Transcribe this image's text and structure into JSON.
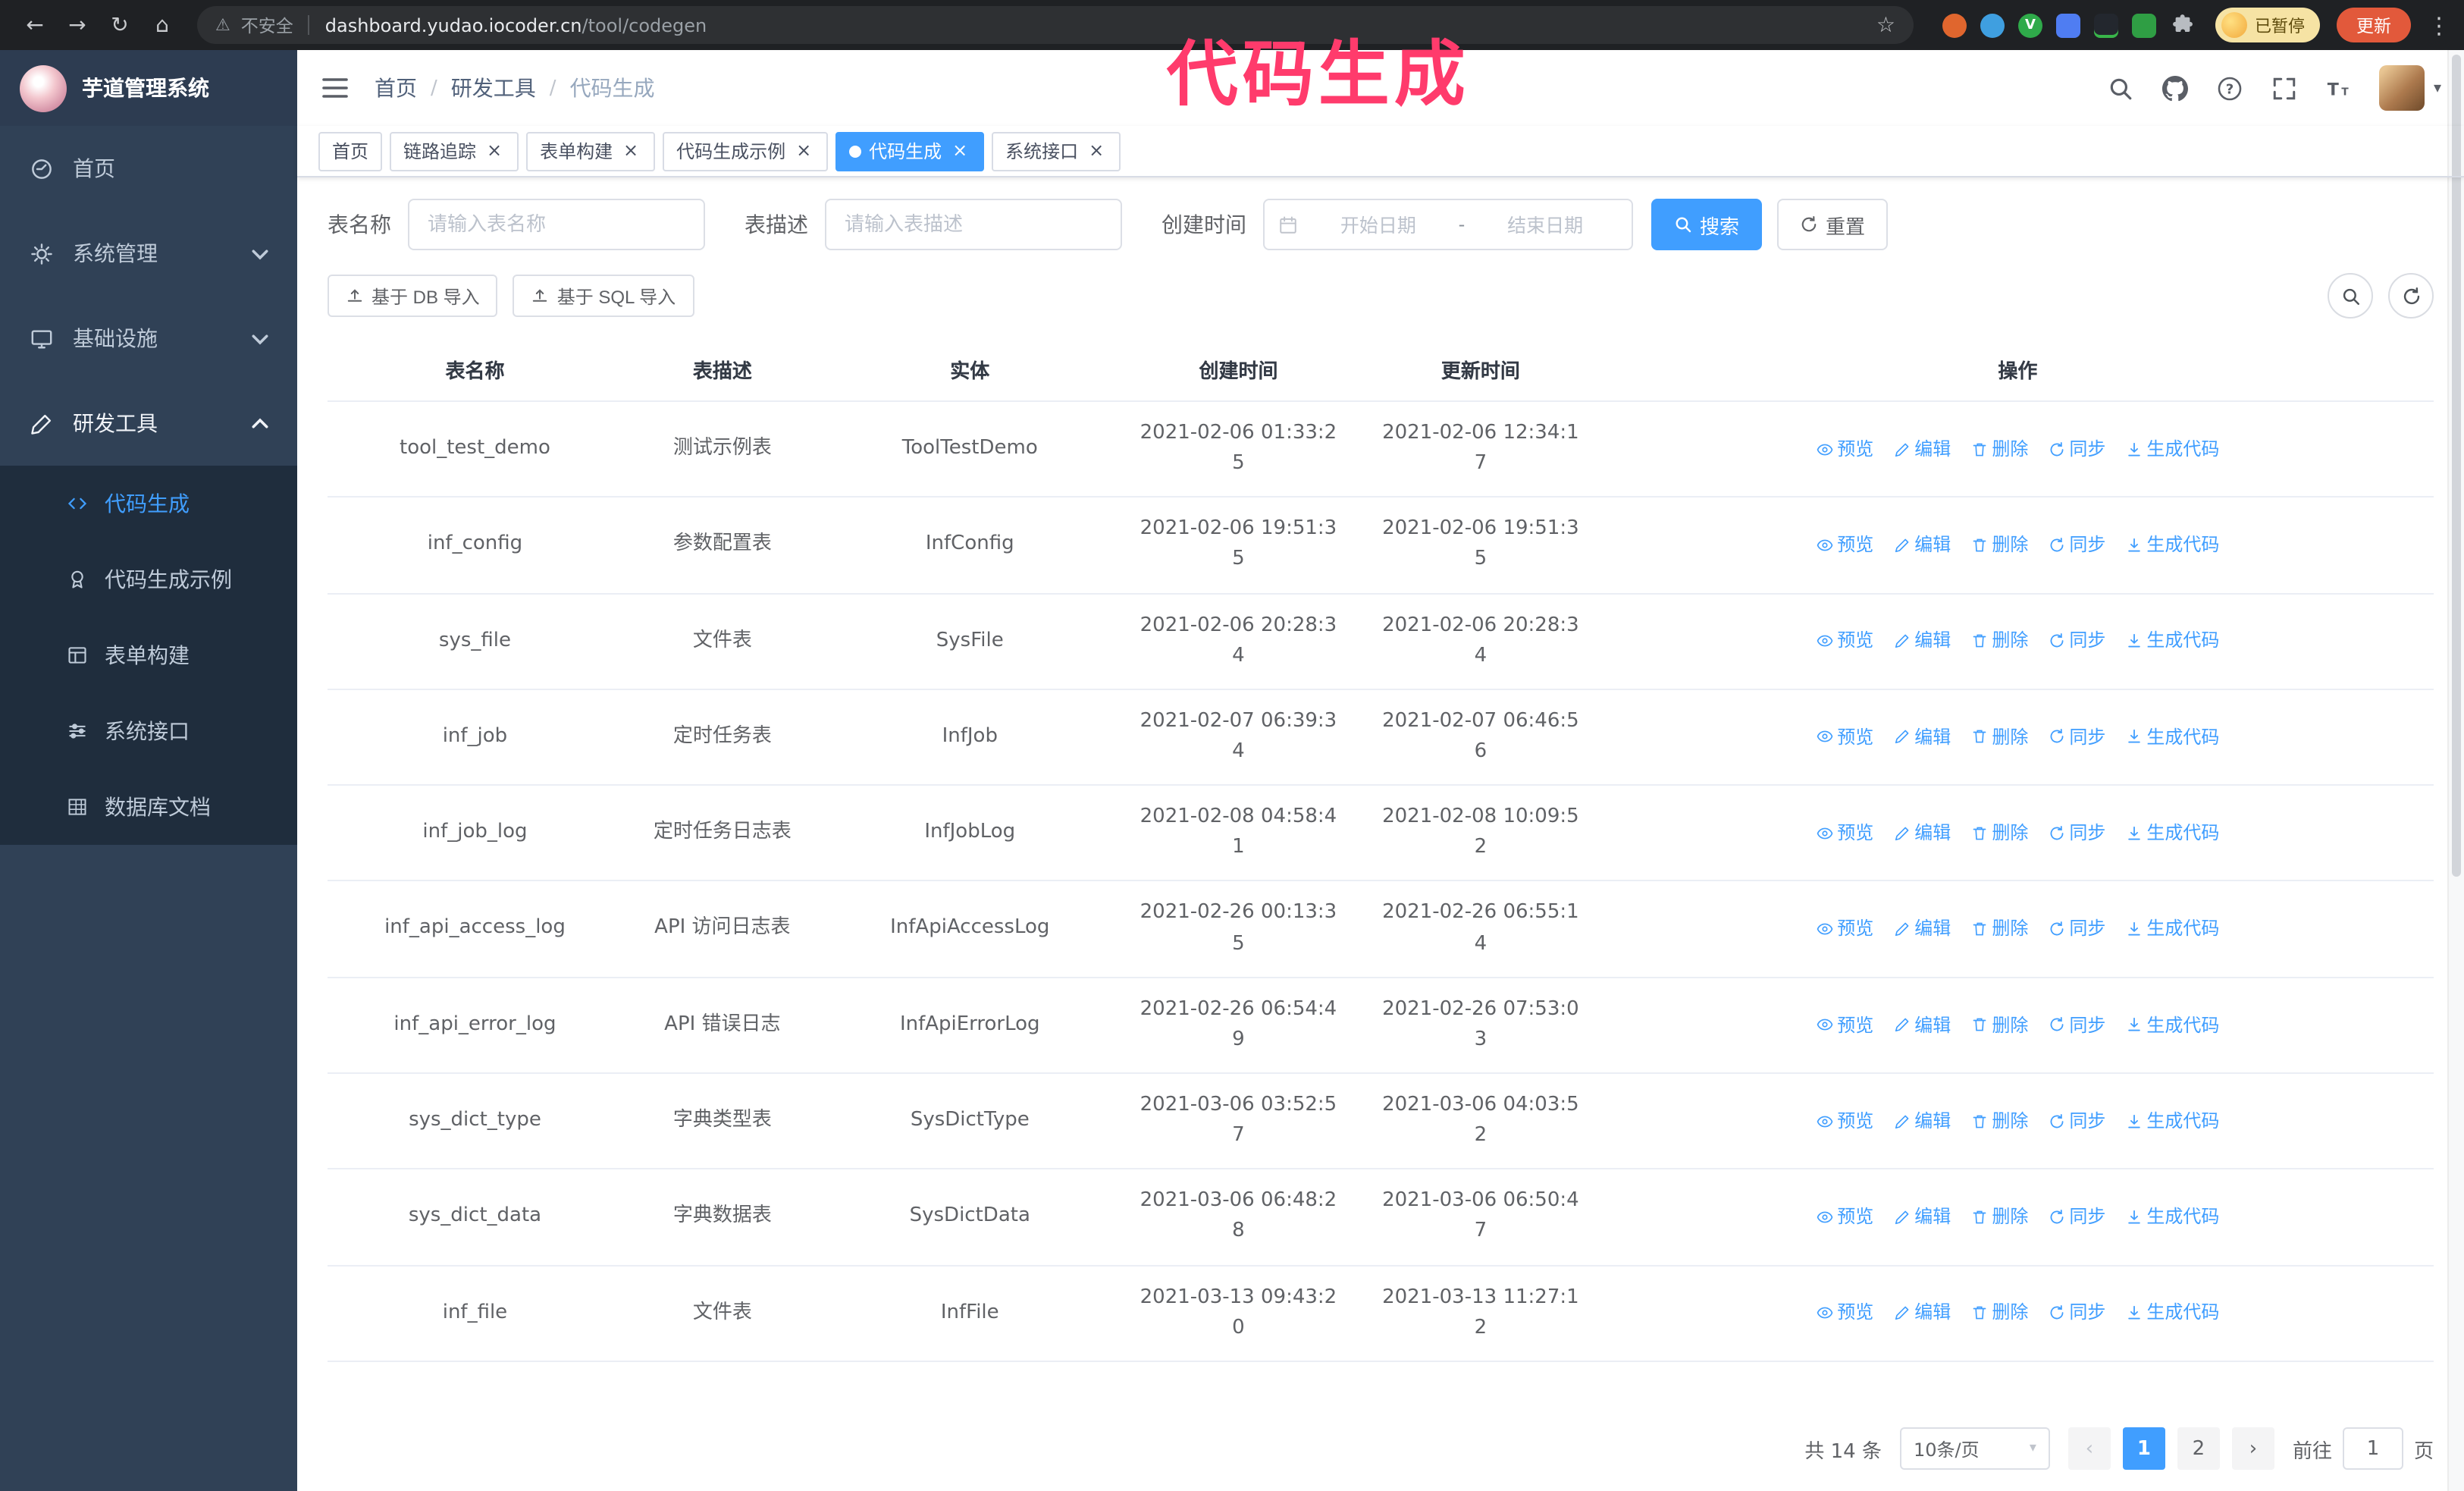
{
  "colors": {
    "accent": "#409eff",
    "sidebar_bg": "#304156",
    "submenu_bg": "#1f2d3d",
    "annotation": "#ff3b6c",
    "active_tab_bg": "#409eff"
  },
  "browser": {
    "security_label": "不安全",
    "url_domain": "dashboard.yudao.iocoder.cn",
    "url_path": "/tool/codegen",
    "profile_badge": "已暂停",
    "update_button": "更新"
  },
  "annotation": {
    "text": "代码生成",
    "color": "#ff3b6c"
  },
  "sidebar": {
    "logo_title": "芋道管理系统",
    "items": [
      {
        "label": "首页",
        "icon": "dashboard-icon"
      },
      {
        "label": "系统管理",
        "icon": "gear-icon",
        "expandable": true
      },
      {
        "label": "基础设施",
        "icon": "monitor-icon",
        "expandable": true
      },
      {
        "label": "研发工具",
        "icon": "tools-icon",
        "expandable": true,
        "expanded": true
      }
    ],
    "subitems": [
      {
        "label": "代码生成",
        "icon": "code-icon",
        "active": true
      },
      {
        "label": "代码生成示例",
        "icon": "medal-icon"
      },
      {
        "label": "表单构建",
        "icon": "form-icon"
      },
      {
        "label": "系统接口",
        "icon": "api-icon"
      },
      {
        "label": "数据库文档",
        "icon": "table-grid-icon"
      }
    ]
  },
  "breadcrumb": {
    "items": [
      "首页",
      "研发工具",
      "代码生成"
    ],
    "separator": "/"
  },
  "tabs": [
    {
      "label": "首页",
      "closable": false,
      "active": false
    },
    {
      "label": "链路追踪",
      "closable": true,
      "active": false
    },
    {
      "label": "表单构建",
      "closable": true,
      "active": false
    },
    {
      "label": "代码生成示例",
      "closable": true,
      "active": false
    },
    {
      "label": "代码生成",
      "closable": true,
      "active": true
    },
    {
      "label": "系统接口",
      "closable": true,
      "active": false
    }
  ],
  "filters": {
    "table_name_label": "表名称",
    "table_name_placeholder": "请输入表名称",
    "table_desc_label": "表描述",
    "table_desc_placeholder": "请输入表描述",
    "create_time_label": "创建时间",
    "date_start_placeholder": "开始日期",
    "date_separator": "-",
    "date_end_placeholder": "结束日期",
    "search_button": "搜索",
    "reset_button": "重置"
  },
  "toolbar": {
    "import_db_button": "基于 DB 导入",
    "import_sql_button": "基于 SQL 导入"
  },
  "table": {
    "columns": [
      "表名称",
      "表描述",
      "实体",
      "创建时间",
      "更新时间",
      "操作"
    ],
    "actions": [
      "预览",
      "编辑",
      "删除",
      "同步",
      "生成代码"
    ],
    "rows": [
      {
        "name": "tool_test_demo",
        "desc": "测试示例表",
        "entity": "ToolTestDemo",
        "created": "2021-02-06 01:33:25",
        "updated": "2021-02-06 12:34:17"
      },
      {
        "name": "inf_config",
        "desc": "参数配置表",
        "entity": "InfConfig",
        "created": "2021-02-06 19:51:35",
        "updated": "2021-02-06 19:51:35"
      },
      {
        "name": "sys_file",
        "desc": "文件表",
        "entity": "SysFile",
        "created": "2021-02-06 20:28:34",
        "updated": "2021-02-06 20:28:34"
      },
      {
        "name": "inf_job",
        "desc": "定时任务表",
        "entity": "InfJob",
        "created": "2021-02-07 06:39:34",
        "updated": "2021-02-07 06:46:56"
      },
      {
        "name": "inf_job_log",
        "desc": "定时任务日志表",
        "entity": "InfJobLog",
        "created": "2021-02-08 04:58:41",
        "updated": "2021-02-08 10:09:52"
      },
      {
        "name": "inf_api_access_log",
        "desc": "API 访问日志表",
        "entity": "InfApiAccessLog",
        "created": "2021-02-26 00:13:35",
        "updated": "2021-02-26 06:55:14"
      },
      {
        "name": "inf_api_error_log",
        "desc": "API 错误日志",
        "entity": "InfApiErrorLog",
        "created": "2021-02-26 06:54:49",
        "updated": "2021-02-26 07:53:03"
      },
      {
        "name": "sys_dict_type",
        "desc": "字典类型表",
        "entity": "SysDictType",
        "created": "2021-03-06 03:52:57",
        "updated": "2021-03-06 04:03:52"
      },
      {
        "name": "sys_dict_data",
        "desc": "字典数据表",
        "entity": "SysDictData",
        "created": "2021-03-06 06:48:28",
        "updated": "2021-03-06 06:50:47"
      },
      {
        "name": "inf_file",
        "desc": "文件表",
        "entity": "InfFile",
        "created": "2021-03-13 09:43:20",
        "updated": "2021-03-13 11:27:12"
      }
    ]
  },
  "pagination": {
    "total_label": "共 14 条",
    "page_size_value": "10条/页",
    "pages": [
      "1",
      "2"
    ],
    "active_page": "1",
    "goto_prefix": "前往",
    "goto_value": "1",
    "goto_suffix": "页"
  }
}
